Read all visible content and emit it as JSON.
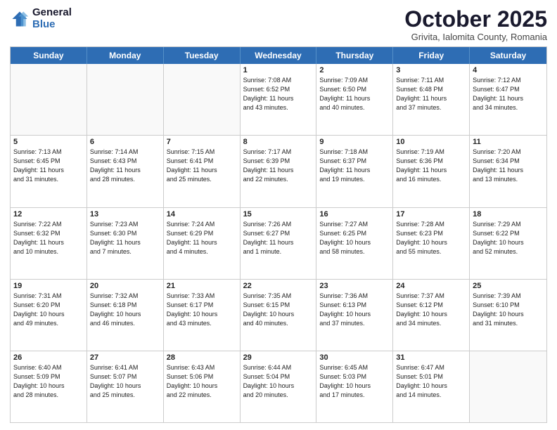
{
  "header": {
    "logo_general": "General",
    "logo_blue": "Blue",
    "month_title": "October 2025",
    "subtitle": "Grivita, Ialomita County, Romania"
  },
  "days_of_week": [
    "Sunday",
    "Monday",
    "Tuesday",
    "Wednesday",
    "Thursday",
    "Friday",
    "Saturday"
  ],
  "weeks": [
    [
      {
        "day": "",
        "info": ""
      },
      {
        "day": "",
        "info": ""
      },
      {
        "day": "",
        "info": ""
      },
      {
        "day": "1",
        "info": "Sunrise: 7:08 AM\nSunset: 6:52 PM\nDaylight: 11 hours\nand 43 minutes."
      },
      {
        "day": "2",
        "info": "Sunrise: 7:09 AM\nSunset: 6:50 PM\nDaylight: 11 hours\nand 40 minutes."
      },
      {
        "day": "3",
        "info": "Sunrise: 7:11 AM\nSunset: 6:48 PM\nDaylight: 11 hours\nand 37 minutes."
      },
      {
        "day": "4",
        "info": "Sunrise: 7:12 AM\nSunset: 6:47 PM\nDaylight: 11 hours\nand 34 minutes."
      }
    ],
    [
      {
        "day": "5",
        "info": "Sunrise: 7:13 AM\nSunset: 6:45 PM\nDaylight: 11 hours\nand 31 minutes."
      },
      {
        "day": "6",
        "info": "Sunrise: 7:14 AM\nSunset: 6:43 PM\nDaylight: 11 hours\nand 28 minutes."
      },
      {
        "day": "7",
        "info": "Sunrise: 7:15 AM\nSunset: 6:41 PM\nDaylight: 11 hours\nand 25 minutes."
      },
      {
        "day": "8",
        "info": "Sunrise: 7:17 AM\nSunset: 6:39 PM\nDaylight: 11 hours\nand 22 minutes."
      },
      {
        "day": "9",
        "info": "Sunrise: 7:18 AM\nSunset: 6:37 PM\nDaylight: 11 hours\nand 19 minutes."
      },
      {
        "day": "10",
        "info": "Sunrise: 7:19 AM\nSunset: 6:36 PM\nDaylight: 11 hours\nand 16 minutes."
      },
      {
        "day": "11",
        "info": "Sunrise: 7:20 AM\nSunset: 6:34 PM\nDaylight: 11 hours\nand 13 minutes."
      }
    ],
    [
      {
        "day": "12",
        "info": "Sunrise: 7:22 AM\nSunset: 6:32 PM\nDaylight: 11 hours\nand 10 minutes."
      },
      {
        "day": "13",
        "info": "Sunrise: 7:23 AM\nSunset: 6:30 PM\nDaylight: 11 hours\nand 7 minutes."
      },
      {
        "day": "14",
        "info": "Sunrise: 7:24 AM\nSunset: 6:29 PM\nDaylight: 11 hours\nand 4 minutes."
      },
      {
        "day": "15",
        "info": "Sunrise: 7:26 AM\nSunset: 6:27 PM\nDaylight: 11 hours\nand 1 minute."
      },
      {
        "day": "16",
        "info": "Sunrise: 7:27 AM\nSunset: 6:25 PM\nDaylight: 10 hours\nand 58 minutes."
      },
      {
        "day": "17",
        "info": "Sunrise: 7:28 AM\nSunset: 6:23 PM\nDaylight: 10 hours\nand 55 minutes."
      },
      {
        "day": "18",
        "info": "Sunrise: 7:29 AM\nSunset: 6:22 PM\nDaylight: 10 hours\nand 52 minutes."
      }
    ],
    [
      {
        "day": "19",
        "info": "Sunrise: 7:31 AM\nSunset: 6:20 PM\nDaylight: 10 hours\nand 49 minutes."
      },
      {
        "day": "20",
        "info": "Sunrise: 7:32 AM\nSunset: 6:18 PM\nDaylight: 10 hours\nand 46 minutes."
      },
      {
        "day": "21",
        "info": "Sunrise: 7:33 AM\nSunset: 6:17 PM\nDaylight: 10 hours\nand 43 minutes."
      },
      {
        "day": "22",
        "info": "Sunrise: 7:35 AM\nSunset: 6:15 PM\nDaylight: 10 hours\nand 40 minutes."
      },
      {
        "day": "23",
        "info": "Sunrise: 7:36 AM\nSunset: 6:13 PM\nDaylight: 10 hours\nand 37 minutes."
      },
      {
        "day": "24",
        "info": "Sunrise: 7:37 AM\nSunset: 6:12 PM\nDaylight: 10 hours\nand 34 minutes."
      },
      {
        "day": "25",
        "info": "Sunrise: 7:39 AM\nSunset: 6:10 PM\nDaylight: 10 hours\nand 31 minutes."
      }
    ],
    [
      {
        "day": "26",
        "info": "Sunrise: 6:40 AM\nSunset: 5:09 PM\nDaylight: 10 hours\nand 28 minutes."
      },
      {
        "day": "27",
        "info": "Sunrise: 6:41 AM\nSunset: 5:07 PM\nDaylight: 10 hours\nand 25 minutes."
      },
      {
        "day": "28",
        "info": "Sunrise: 6:43 AM\nSunset: 5:06 PM\nDaylight: 10 hours\nand 22 minutes."
      },
      {
        "day": "29",
        "info": "Sunrise: 6:44 AM\nSunset: 5:04 PM\nDaylight: 10 hours\nand 20 minutes."
      },
      {
        "day": "30",
        "info": "Sunrise: 6:45 AM\nSunset: 5:03 PM\nDaylight: 10 hours\nand 17 minutes."
      },
      {
        "day": "31",
        "info": "Sunrise: 6:47 AM\nSunset: 5:01 PM\nDaylight: 10 hours\nand 14 minutes."
      },
      {
        "day": "",
        "info": ""
      }
    ]
  ]
}
